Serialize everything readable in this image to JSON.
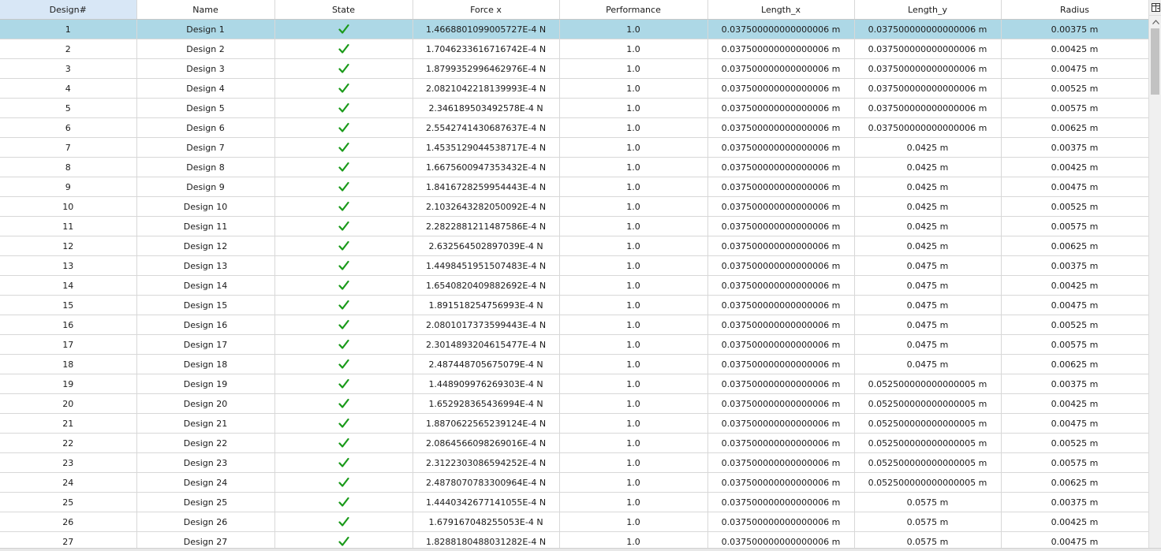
{
  "columns": [
    "Design#",
    "Name",
    "State",
    "Force x",
    "Performance",
    "Length_x",
    "Length_y",
    "Radius"
  ],
  "accent": {
    "selected_row": "#add8e6",
    "sorted_header": "#d8e7f6",
    "check": "#1a9a1a"
  },
  "state_icon": "check-icon",
  "rows": [
    {
      "idx": "1",
      "name": "Design 1",
      "force": "1.4668801099005727E-4 N",
      "perf": "1.0",
      "lx": "0.037500000000000006 m",
      "ly": "0.037500000000000006 m",
      "r": "0.00375 m"
    },
    {
      "idx": "2",
      "name": "Design 2",
      "force": "1.7046233616716742E-4 N",
      "perf": "1.0",
      "lx": "0.037500000000000006 m",
      "ly": "0.037500000000000006 m",
      "r": "0.00425 m"
    },
    {
      "idx": "3",
      "name": "Design 3",
      "force": "1.8799352996462976E-4 N",
      "perf": "1.0",
      "lx": "0.037500000000000006 m",
      "ly": "0.037500000000000006 m",
      "r": "0.00475 m"
    },
    {
      "idx": "4",
      "name": "Design 4",
      "force": "2.0821042218139993E-4 N",
      "perf": "1.0",
      "lx": "0.037500000000000006 m",
      "ly": "0.037500000000000006 m",
      "r": "0.00525 m"
    },
    {
      "idx": "5",
      "name": "Design 5",
      "force": "2.346189503492578E-4 N",
      "perf": "1.0",
      "lx": "0.037500000000000006 m",
      "ly": "0.037500000000000006 m",
      "r": "0.00575 m"
    },
    {
      "idx": "6",
      "name": "Design 6",
      "force": "2.5542741430687637E-4 N",
      "perf": "1.0",
      "lx": "0.037500000000000006 m",
      "ly": "0.037500000000000006 m",
      "r": "0.00625 m"
    },
    {
      "idx": "7",
      "name": "Design 7",
      "force": "1.4535129044538717E-4 N",
      "perf": "1.0",
      "lx": "0.037500000000000006 m",
      "ly": "0.0425 m",
      "r": "0.00375 m"
    },
    {
      "idx": "8",
      "name": "Design 8",
      "force": "1.6675600947353432E-4 N",
      "perf": "1.0",
      "lx": "0.037500000000000006 m",
      "ly": "0.0425 m",
      "r": "0.00425 m"
    },
    {
      "idx": "9",
      "name": "Design 9",
      "force": "1.8416728259954443E-4 N",
      "perf": "1.0",
      "lx": "0.037500000000000006 m",
      "ly": "0.0425 m",
      "r": "0.00475 m"
    },
    {
      "idx": "10",
      "name": "Design 10",
      "force": "2.1032643282050092E-4 N",
      "perf": "1.0",
      "lx": "0.037500000000000006 m",
      "ly": "0.0425 m",
      "r": "0.00525 m"
    },
    {
      "idx": "11",
      "name": "Design 11",
      "force": "2.2822881211487586E-4 N",
      "perf": "1.0",
      "lx": "0.037500000000000006 m",
      "ly": "0.0425 m",
      "r": "0.00575 m"
    },
    {
      "idx": "12",
      "name": "Design 12",
      "force": "2.632564502897039E-4 N",
      "perf": "1.0",
      "lx": "0.037500000000000006 m",
      "ly": "0.0425 m",
      "r": "0.00625 m"
    },
    {
      "idx": "13",
      "name": "Design 13",
      "force": "1.4498451951507483E-4 N",
      "perf": "1.0",
      "lx": "0.037500000000000006 m",
      "ly": "0.0475 m",
      "r": "0.00375 m"
    },
    {
      "idx": "14",
      "name": "Design 14",
      "force": "1.6540820409882692E-4 N",
      "perf": "1.0",
      "lx": "0.037500000000000006 m",
      "ly": "0.0475 m",
      "r": "0.00425 m"
    },
    {
      "idx": "15",
      "name": "Design 15",
      "force": "1.891518254756993E-4 N",
      "perf": "1.0",
      "lx": "0.037500000000000006 m",
      "ly": "0.0475 m",
      "r": "0.00475 m"
    },
    {
      "idx": "16",
      "name": "Design 16",
      "force": "2.0801017373599443E-4 N",
      "perf": "1.0",
      "lx": "0.037500000000000006 m",
      "ly": "0.0475 m",
      "r": "0.00525 m"
    },
    {
      "idx": "17",
      "name": "Design 17",
      "force": "2.3014893204615477E-4 N",
      "perf": "1.0",
      "lx": "0.037500000000000006 m",
      "ly": "0.0475 m",
      "r": "0.00575 m"
    },
    {
      "idx": "18",
      "name": "Design 18",
      "force": "2.487448705675079E-4 N",
      "perf": "1.0",
      "lx": "0.037500000000000006 m",
      "ly": "0.0475 m",
      "r": "0.00625 m"
    },
    {
      "idx": "19",
      "name": "Design 19",
      "force": "1.448909976269303E-4 N",
      "perf": "1.0",
      "lx": "0.037500000000000006 m",
      "ly": "0.052500000000000005 m",
      "r": "0.00375 m"
    },
    {
      "idx": "20",
      "name": "Design 20",
      "force": "1.652928365436994E-4 N",
      "perf": "1.0",
      "lx": "0.037500000000000006 m",
      "ly": "0.052500000000000005 m",
      "r": "0.00425 m"
    },
    {
      "idx": "21",
      "name": "Design 21",
      "force": "1.8870622565239124E-4 N",
      "perf": "1.0",
      "lx": "0.037500000000000006 m",
      "ly": "0.052500000000000005 m",
      "r": "0.00475 m"
    },
    {
      "idx": "22",
      "name": "Design 22",
      "force": "2.0864566098269016E-4 N",
      "perf": "1.0",
      "lx": "0.037500000000000006 m",
      "ly": "0.052500000000000005 m",
      "r": "0.00525 m"
    },
    {
      "idx": "23",
      "name": "Design 23",
      "force": "2.3122303086594252E-4 N",
      "perf": "1.0",
      "lx": "0.037500000000000006 m",
      "ly": "0.052500000000000005 m",
      "r": "0.00575 m"
    },
    {
      "idx": "24",
      "name": "Design 24",
      "force": "2.4878070783300964E-4 N",
      "perf": "1.0",
      "lx": "0.037500000000000006 m",
      "ly": "0.052500000000000005 m",
      "r": "0.00625 m"
    },
    {
      "idx": "25",
      "name": "Design 25",
      "force": "1.4440342677141055E-4 N",
      "perf": "1.0",
      "lx": "0.037500000000000006 m",
      "ly": "0.0575 m",
      "r": "0.00375 m"
    },
    {
      "idx": "26",
      "name": "Design 26",
      "force": "1.679167048255053E-4 N",
      "perf": "1.0",
      "lx": "0.037500000000000006 m",
      "ly": "0.0575 m",
      "r": "0.00425 m"
    },
    {
      "idx": "27",
      "name": "Design 27",
      "force": "1.8288180488031282E-4 N",
      "perf": "1.0",
      "lx": "0.037500000000000006 m",
      "ly": "0.0575 m",
      "r": "0.00475 m"
    }
  ]
}
